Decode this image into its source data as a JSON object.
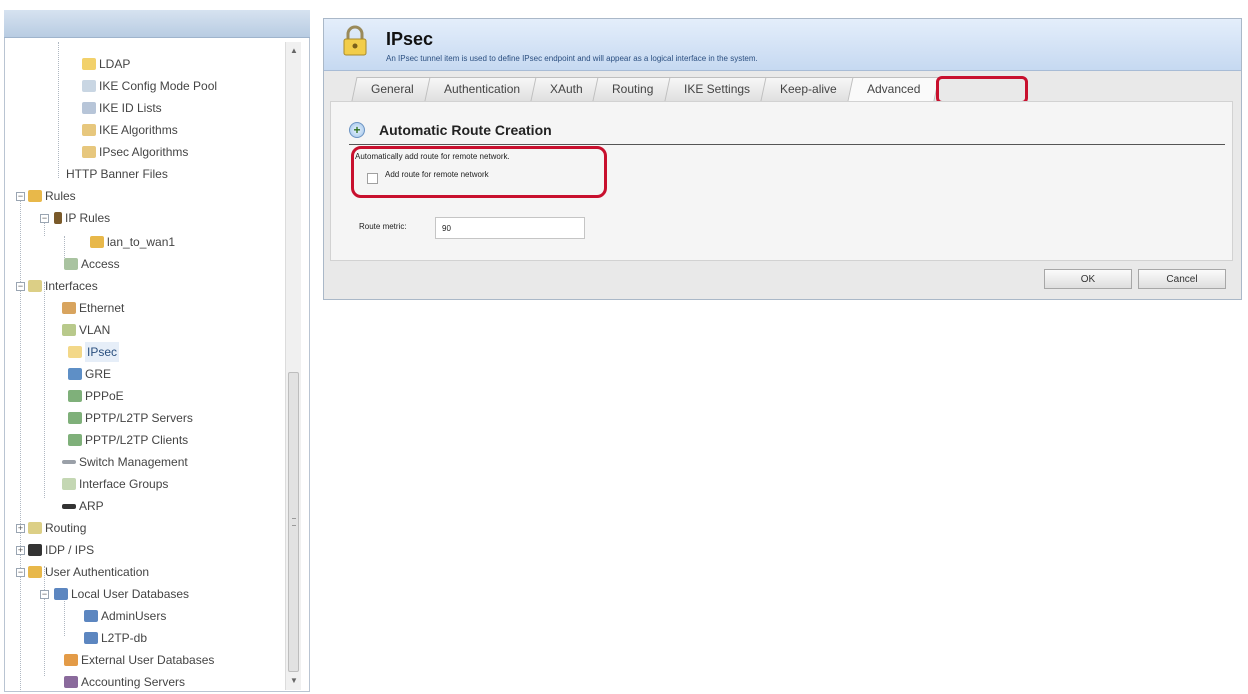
{
  "tree": {
    "items": [
      {
        "label": "LDAP"
      },
      {
        "label": "IKE Config Mode Pool"
      },
      {
        "label": "IKE ID Lists"
      },
      {
        "label": "IKE Algorithms"
      },
      {
        "label": "IPsec Algorithms"
      },
      {
        "label": "HTTP Banner Files"
      },
      {
        "label": "Rules"
      },
      {
        "label": "IP Rules"
      },
      {
        "label": "lan_to_wan1"
      },
      {
        "label": "Access"
      },
      {
        "label": "Interfaces"
      },
      {
        "label": "Ethernet"
      },
      {
        "label": "VLAN"
      },
      {
        "label": "IPsec"
      },
      {
        "label": "GRE"
      },
      {
        "label": "PPPoE"
      },
      {
        "label": "PPTP/L2TP Servers"
      },
      {
        "label": "PPTP/L2TP Clients"
      },
      {
        "label": "Switch Management"
      },
      {
        "label": "Interface Groups"
      },
      {
        "label": "ARP"
      },
      {
        "label": "Routing"
      },
      {
        "label": "IDP / IPS"
      },
      {
        "label": "User Authentication"
      },
      {
        "label": "Local User Databases"
      },
      {
        "label": "AdminUsers"
      },
      {
        "label": "L2TP-db"
      },
      {
        "label": "External User Databases"
      },
      {
        "label": "Accounting Servers"
      }
    ]
  },
  "dialog": {
    "title": "IPsec",
    "description": "An IPsec tunnel item is used to define IPsec endpoint and will appear as a logical interface in the system.",
    "tabs": [
      {
        "label": "General"
      },
      {
        "label": "Authentication"
      },
      {
        "label": "XAuth"
      },
      {
        "label": "Routing"
      },
      {
        "label": "IKE Settings"
      },
      {
        "label": "Keep-alive"
      },
      {
        "label": "Advanced"
      }
    ],
    "active_tab": "Advanced",
    "section": {
      "title": "Automatic Route Creation",
      "auto_route_text": "Automatically add route for remote network.",
      "add_route_checkbox_label": "Add route for remote network",
      "add_route_checked": false,
      "route_metric_label": "Route metric:",
      "route_metric_value": "90"
    },
    "buttons": {
      "ok": "OK",
      "cancel": "Cancel"
    }
  },
  "colors": {
    "highlight": "#c8102e",
    "header_blue": "#c6d9f1"
  }
}
